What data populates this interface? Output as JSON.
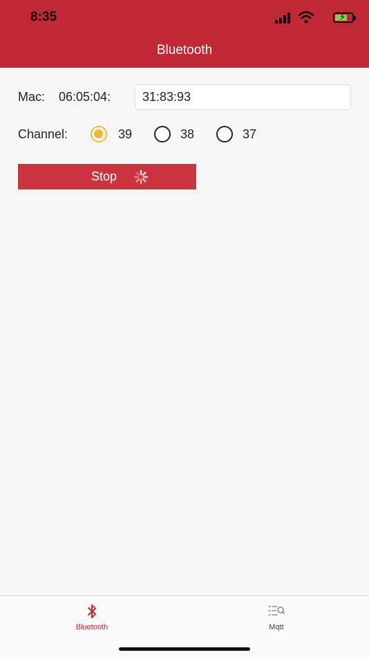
{
  "status_bar": {
    "time": "8:35"
  },
  "header": {
    "title": "Bluetooth"
  },
  "form": {
    "mac_label": "Mac:",
    "mac_prefix": "06:05:04:",
    "mac_value": "31:83:93",
    "channel_label": "Channel:",
    "channels": [
      {
        "label": "39",
        "checked": true
      },
      {
        "label": "38",
        "checked": false
      },
      {
        "label": "37",
        "checked": false
      }
    ],
    "stop_label": "Stop"
  },
  "tabs": [
    {
      "label": "Bluetooth",
      "icon": "bluetooth-icon",
      "active": true
    },
    {
      "label": "Mqtt",
      "icon": "mqtt-list-search-icon",
      "active": false
    }
  ],
  "colors": {
    "brand": "#c12835",
    "button": "#c9343f",
    "radio_checked": "#f0b83a",
    "tab_inactive": "#8a8a8a"
  }
}
